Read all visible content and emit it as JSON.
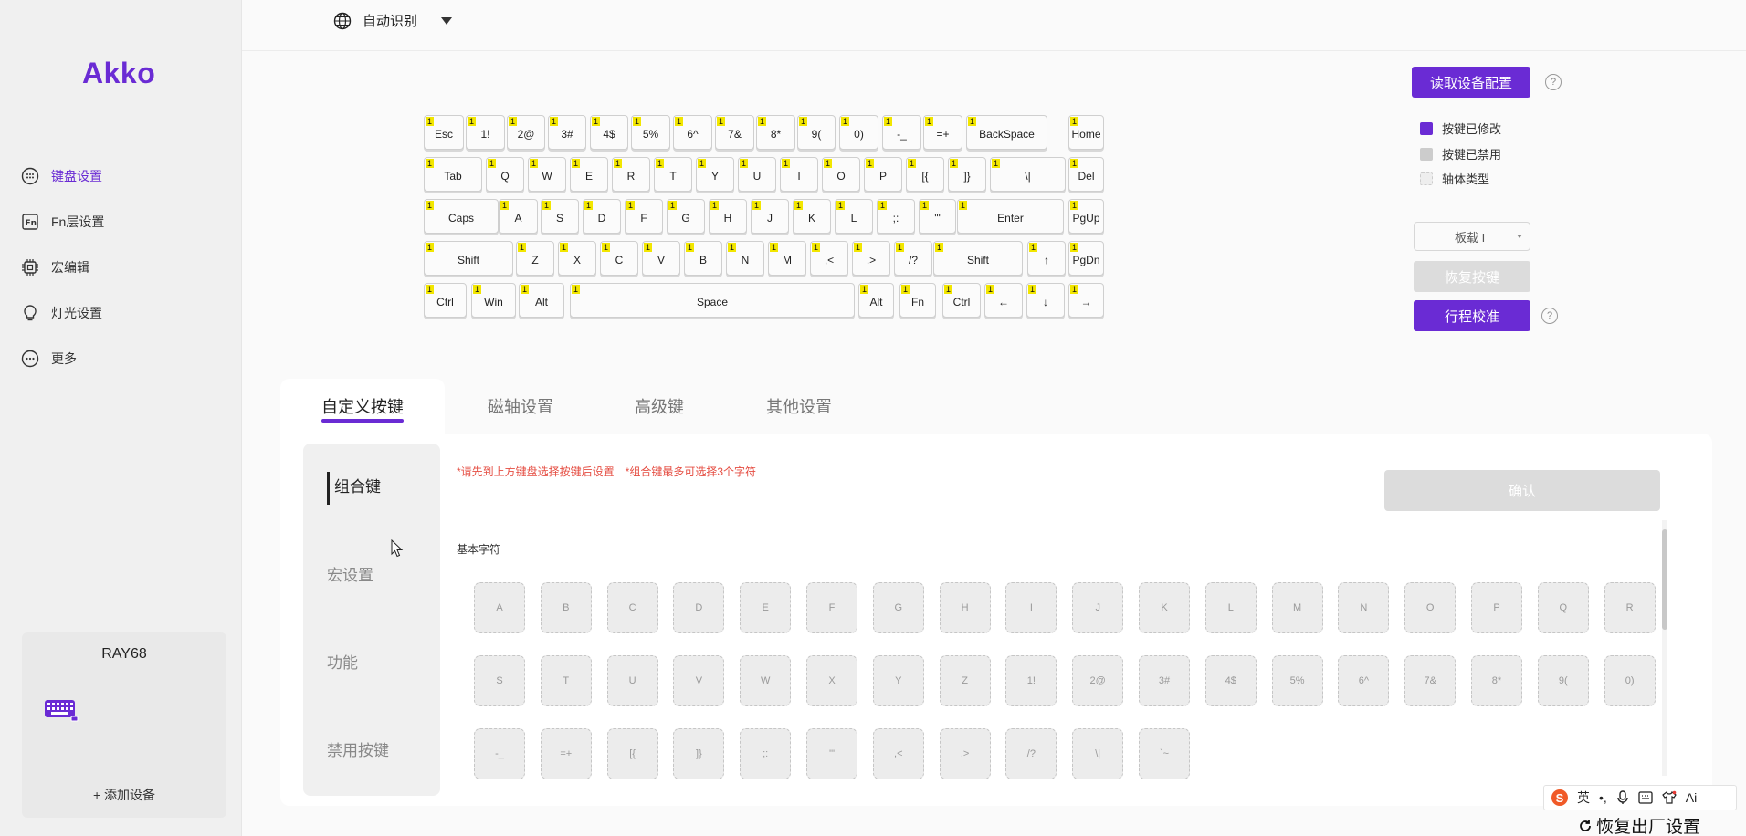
{
  "app": {
    "logo": "Akko"
  },
  "topbar": {
    "language": "自动识别"
  },
  "sidebar": {
    "items": [
      {
        "label": "键盘设置",
        "icon": "keyboard-icon"
      },
      {
        "label": "Fn层设置",
        "icon": "fn-icon"
      },
      {
        "label": "宏编辑",
        "icon": "chip-icon"
      },
      {
        "label": "灯光设置",
        "icon": "bulb-icon"
      },
      {
        "label": "更多",
        "icon": "more-icon"
      }
    ],
    "device": {
      "name": "RAY68",
      "add_label": "+ 添加设备"
    }
  },
  "keyboard": {
    "layer_badge": "1",
    "rows": [
      [
        "Esc",
        "1!",
        "2@",
        "3#",
        "4$",
        "5%",
        "6^",
        "7&",
        "8*",
        "9(",
        "0)",
        "-_",
        "=+",
        "BackSpace",
        "Home"
      ],
      [
        "Tab",
        "Q",
        "W",
        "E",
        "R",
        "T",
        "Y",
        "U",
        "I",
        "O",
        "P",
        "[{",
        "]}",
        "\\|",
        "Del"
      ],
      [
        "Caps",
        "A",
        "S",
        "D",
        "F",
        "G",
        "H",
        "J",
        "K",
        "L",
        ";:",
        "'\"",
        "Enter",
        "PgUp"
      ],
      [
        "Shift",
        "Z",
        "X",
        "C",
        "V",
        "B",
        "N",
        "M",
        ",<",
        ".>",
        "/?",
        "Shift",
        "↑",
        "PgDn"
      ],
      [
        "Ctrl",
        "Win",
        "Alt",
        "Space",
        "Alt",
        "Fn",
        "Ctrl",
        "←",
        "↓",
        "→"
      ]
    ]
  },
  "right_panel": {
    "read_config": "读取设备配置",
    "help": "?",
    "legend": [
      {
        "label": "按键已修改",
        "color": "#6a2bd4"
      },
      {
        "label": "按键已禁用",
        "color": "#cccccc"
      },
      {
        "label": "轴体类型",
        "color": "#eeeeee"
      }
    ],
    "profile": "板载 I",
    "restore": "恢复按键",
    "calibrate": "行程校准"
  },
  "tabs": [
    "自定义按键",
    "磁轴设置",
    "高级键",
    "其他设置"
  ],
  "subnav": [
    "组合键",
    "宏设置",
    "功能",
    "禁用按键"
  ],
  "notes": [
    "*请先到上方键盘选择按键后设置",
    "*组合键最多可选择3个字符"
  ],
  "confirm": "确认",
  "basic_chars": {
    "title": "基本字符",
    "rows": [
      [
        "A",
        "B",
        "C",
        "D",
        "E",
        "F",
        "G",
        "H",
        "I",
        "J",
        "K",
        "L",
        "M",
        "N",
        "O",
        "P",
        "Q",
        "R"
      ],
      [
        "S",
        "T",
        "U",
        "V",
        "W",
        "X",
        "Y",
        "Z",
        "1!",
        "2@",
        "3#",
        "4$",
        "5%",
        "6^",
        "7&",
        "8*",
        "9(",
        "0)"
      ],
      [
        "-_",
        "=+",
        "[{",
        "]}",
        ";:",
        "'\"",
        ",<",
        ".>",
        "/?",
        "\\|",
        "`~"
      ]
    ]
  },
  "ime": {
    "logo": "S",
    "mode": "英",
    "ai": "Ai"
  },
  "footer": {
    "factory_reset": "恢复出厂设置"
  }
}
